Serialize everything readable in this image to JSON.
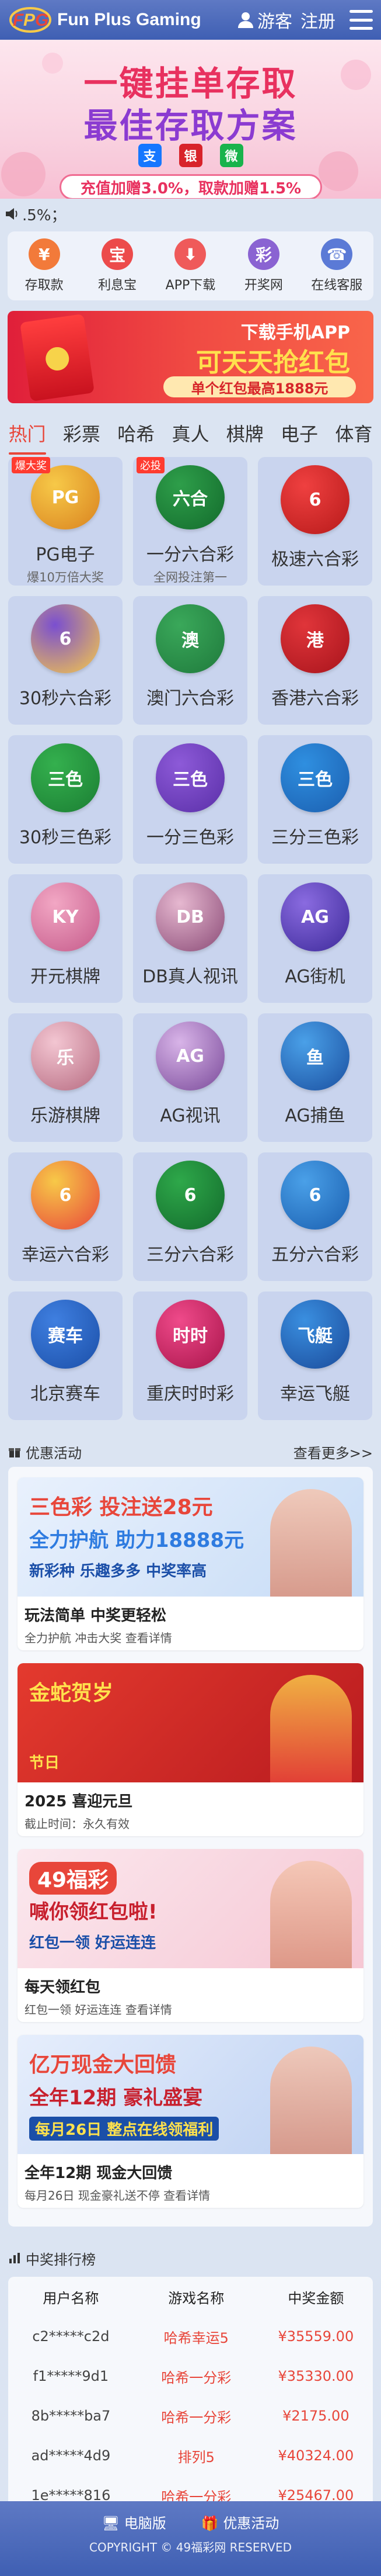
{
  "header": {
    "brand": "Fun Plus Gaming",
    "guest_label": "游客",
    "register_label": "注册"
  },
  "banner": {
    "line1": "一键挂单存取",
    "line2": "最佳存取方案",
    "offer": "充值加赠3.0%，取款加赠1.5%",
    "pay_icons": [
      {
        "name": "alipay-icon",
        "glyph": "支",
        "color": "#1677ff"
      },
      {
        "name": "unionpay-icon",
        "glyph": "银",
        "color": "#d8232a"
      },
      {
        "name": "wechat-icon",
        "glyph": "微",
        "color": "#19b34c"
      }
    ]
  },
  "marquee": {
    "text": ".5%；"
  },
  "quick_nav": [
    {
      "label": "存取款",
      "icon": "deposit-icon",
      "color": "#f27a3a",
      "glyph": "¥"
    },
    {
      "label": "利息宝",
      "icon": "interest-icon",
      "color": "#ec4b4b",
      "glyph": "宝"
    },
    {
      "label": "APP下载",
      "icon": "download-icon",
      "color": "#ef5a5a",
      "glyph": "⬇"
    },
    {
      "label": "开奖网",
      "icon": "lottery-icon",
      "color": "#8a63d2",
      "glyph": "彩"
    },
    {
      "label": "在线客服",
      "icon": "support-icon",
      "color": "#5b7ad6",
      "glyph": "☎"
    }
  ],
  "red_packet": {
    "line1": "下载手机APP",
    "line2": "可天天抢红包",
    "line3": "单个红包最高1888元"
  },
  "tabs": [
    "热门",
    "彩票",
    "哈希",
    "真人",
    "棋牌",
    "电子",
    "体育"
  ],
  "active_tab": 0,
  "games": [
    {
      "name": "PG电子",
      "sub": "爆10万倍大奖",
      "badge": "爆大奖",
      "glyph": "PG",
      "colors": [
        "#f7c948",
        "#d9821f"
      ]
    },
    {
      "name": "一分六合彩",
      "sub": "全网投注第一",
      "badge": "必投",
      "glyph": "六合",
      "colors": [
        "#2e9e4a",
        "#136b2c"
      ]
    },
    {
      "name": "极速六合彩",
      "sub": "",
      "badge": "",
      "glyph": "6",
      "colors": [
        "#ef4040",
        "#b71a1a"
      ]
    },
    {
      "name": "30秒六合彩",
      "sub": "",
      "badge": "",
      "glyph": "6",
      "colors": [
        "#7a4fd0",
        "#f7c948"
      ]
    },
    {
      "name": "澳门六合彩",
      "sub": "",
      "badge": "",
      "glyph": "澳",
      "colors": [
        "#3aa85a",
        "#1f7a3c"
      ]
    },
    {
      "name": "香港六合彩",
      "sub": "",
      "badge": "",
      "glyph": "港",
      "colors": [
        "#e0353a",
        "#a8141c"
      ]
    },
    {
      "name": "30秒三色彩",
      "sub": "",
      "badge": "",
      "glyph": "三色",
      "colors": [
        "#34b04e",
        "#1b7e33"
      ]
    },
    {
      "name": "一分三色彩",
      "sub": "",
      "badge": "",
      "glyph": "三色",
      "colors": [
        "#8d5ad8",
        "#5a2fa8"
      ]
    },
    {
      "name": "三分三色彩",
      "sub": "",
      "badge": "",
      "glyph": "三色",
      "colors": [
        "#2f8fe0",
        "#1b5fb0"
      ]
    },
    {
      "name": "开元棋牌",
      "sub": "",
      "badge": "",
      "glyph": "KY",
      "colors": [
        "#f2a7c4",
        "#c55a8a"
      ]
    },
    {
      "name": "DB真人视讯",
      "sub": "",
      "badge": "",
      "glyph": "DB",
      "colors": [
        "#e6b8d0",
        "#8a4a76"
      ]
    },
    {
      "name": "AG街机",
      "sub": "",
      "badge": "",
      "glyph": "AG",
      "colors": [
        "#8a6be0",
        "#3d2a9a"
      ]
    },
    {
      "name": "乐游棋牌",
      "sub": "",
      "badge": "",
      "glyph": "乐",
      "colors": [
        "#f3c6d2",
        "#b66a80"
      ]
    },
    {
      "name": "AG视讯",
      "sub": "",
      "badge": "",
      "glyph": "AG",
      "colors": [
        "#d8b4e8",
        "#7a4a9a"
      ]
    },
    {
      "name": "AG捕鱼",
      "sub": "",
      "badge": "",
      "glyph": "鱼",
      "colors": [
        "#4aa0e8",
        "#1a4fa0"
      ]
    },
    {
      "name": "幸运六合彩",
      "sub": "",
      "badge": "",
      "glyph": "6",
      "colors": [
        "#f7c948",
        "#e8463a"
      ]
    },
    {
      "name": "三分六合彩",
      "sub": "",
      "badge": "",
      "glyph": "6",
      "colors": [
        "#2ea84a",
        "#136b2c"
      ]
    },
    {
      "name": "五分六合彩",
      "sub": "",
      "badge": "",
      "glyph": "6",
      "colors": [
        "#4aa0e8",
        "#1a5fb0"
      ]
    },
    {
      "name": "北京赛车",
      "sub": "",
      "badge": "",
      "glyph": "赛车",
      "colors": [
        "#3f7fe0",
        "#1b4fa8"
      ]
    },
    {
      "name": "重庆时时彩",
      "sub": "",
      "badge": "",
      "glyph": "时时",
      "colors": [
        "#ef4a8a",
        "#a8144a"
      ]
    },
    {
      "name": "幸运飞艇",
      "sub": "",
      "badge": "",
      "glyph": "飞艇",
      "colors": [
        "#3a8fe0",
        "#1a4a9a"
      ]
    }
  ],
  "promotions": {
    "title": "优惠活动",
    "more": "查看更多>>",
    "items": [
      {
        "banner_line1": "三色彩 投注送28元",
        "banner_line2": "全力护航 助力18888元",
        "banner_line3": "新彩种 乐趣多多 中奖率高",
        "title": "玩法简单  中奖更轻松",
        "desc": "全力护航 冲击大奖  查看详情",
        "bg": [
          "#e9f1fd",
          "#c7dcf6"
        ]
      },
      {
        "banner_line1": "金蛇贺岁",
        "banner_line2": "节日",
        "banner_line3": "",
        "title": "2025 喜迎元旦",
        "desc": "截止时间：永久有效",
        "bg": [
          "#e43a2e",
          "#b81b1f"
        ]
      },
      {
        "banner_line1": "49福彩",
        "banner_line2": "喊你领红包啦!",
        "banner_line3": "红包一领 好运连连",
        "title": "每天领红包",
        "desc": "红包一领 好运连连 查看详情",
        "bg": [
          "#fbe8ee",
          "#f6c7d4"
        ]
      },
      {
        "banner_line1": "亿万现金大回馈",
        "banner_line2": "全年12期  豪礼盛宴",
        "banner_line3": "每月26日 整点在线领福利",
        "title": "全年12期 现金大回馈",
        "desc": "每月26日 现金豪礼送不停 查看详情",
        "bg": [
          "#e6eefc",
          "#bcd0f2"
        ]
      }
    ]
  },
  "ranking": {
    "title": "中奖排行榜",
    "headers": [
      "用户名称",
      "游戏名称",
      "中奖金额"
    ],
    "rows": [
      [
        "c2*****c2d",
        "哈希幸运5",
        "¥35559.00"
      ],
      [
        "f1*****9d1",
        "哈希一分彩",
        "¥35330.00"
      ],
      [
        "8b*****ba7",
        "哈希一分彩",
        "¥2175.00"
      ],
      [
        "ad*****4d9",
        "排列5",
        "¥40324.00"
      ],
      [
        "1e*****816",
        "哈希一分彩",
        "¥25467.00"
      ]
    ]
  },
  "footer": {
    "pc_label": "电脑版",
    "promo_label": "优惠活动",
    "copyright": "COPYRIGHT © 49福彩网 RESERVED"
  }
}
